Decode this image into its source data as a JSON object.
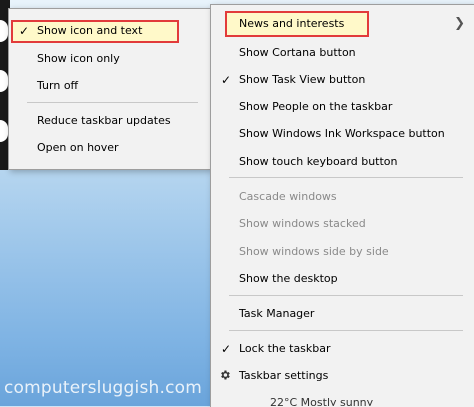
{
  "submenu": {
    "items": [
      {
        "label": "Show icon and text",
        "checked": true,
        "highlighted": true
      },
      {
        "label": "Show icon only",
        "checked": false
      },
      {
        "label": "Turn off",
        "checked": false
      },
      {
        "label": "Reduce taskbar updates",
        "checked": false
      },
      {
        "label": "Open on hover",
        "checked": false
      }
    ]
  },
  "mainmenu": {
    "items": [
      {
        "label": "News and interests",
        "has_submenu": true,
        "highlighted": true
      },
      {
        "label": "Show Cortana button",
        "checked": false
      },
      {
        "label": "Show Task View button",
        "checked": true
      },
      {
        "label": "Show People on the taskbar",
        "checked": false
      },
      {
        "label": "Show Windows Ink Workspace button",
        "checked": false
      },
      {
        "label": "Show touch keyboard button",
        "checked": false
      },
      {
        "label": "Cascade windows",
        "disabled": true
      },
      {
        "label": "Show windows stacked",
        "disabled": true
      },
      {
        "label": "Show windows side by side",
        "disabled": true
      },
      {
        "label": "Show the desktop",
        "disabled": false
      },
      {
        "label": "Task Manager"
      },
      {
        "label": "Lock the taskbar",
        "checked": true
      },
      {
        "label": "Taskbar settings",
        "icon": "gear-icon"
      }
    ]
  },
  "watermark": "computersluggish.com",
  "taskbar_peek": "22°C  Mostly sunny",
  "colors": {
    "highlight_border": "#e23b3b",
    "highlight_fill": "#fff9c9",
    "menu_bg": "#f2f2f2",
    "disabled_text": "#8a8a8a"
  }
}
